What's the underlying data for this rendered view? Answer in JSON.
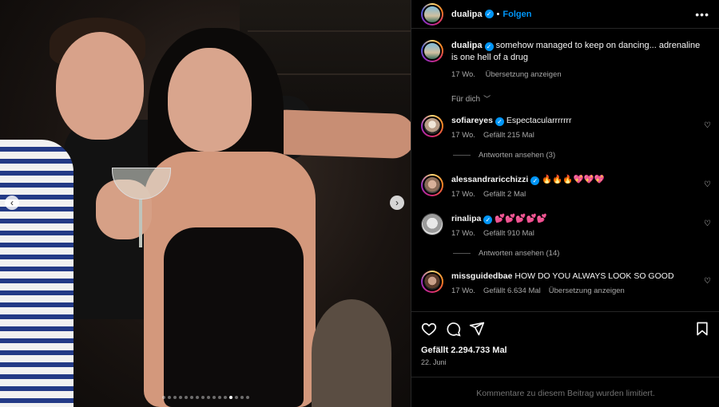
{
  "header": {
    "username": "dualipa",
    "separator": "•",
    "follow_label": "Folgen",
    "more_label": "•••"
  },
  "caption": {
    "username": "dualipa",
    "text": "somehow managed to keep on dancing... adrenaline is one hell of a drug",
    "age": "17 Wo.",
    "translate": "Übersetzung anzeigen"
  },
  "filter": {
    "label": "Für dich",
    "chevron": "﹀"
  },
  "comments": [
    {
      "username": "sofiareyes",
      "text": "Espectacularrrrrrr",
      "age": "17 Wo.",
      "likes": "Gefällt 215 Mal",
      "replies": "Antworten ansehen (3)"
    },
    {
      "username": "alessandraricchizzi",
      "text": "🔥🔥🔥💖💖💖",
      "age": "17 Wo.",
      "likes": "Gefällt 2 Mal"
    },
    {
      "username": "rinalipa",
      "text": "💕💕💕💕💕",
      "age": "17 Wo.",
      "likes": "Gefällt 910 Mal",
      "replies": "Antworten ansehen (14)"
    },
    {
      "username": "missguidedbae",
      "text": "HOW DO YOU ALWAYS LOOK SO GOOD",
      "age": "17 Wo.",
      "likes": "Gefällt 6.634 Mal",
      "translate": "Übersetzung anzeigen"
    }
  ],
  "post": {
    "likes": "Gefällt 2.294.733 Mal",
    "date": "22. Juni",
    "comments_limited": "Kommentare zu diesem Beitrag wurden limitiert."
  },
  "carousel": {
    "total": 16,
    "active_index": 12,
    "prev_glyph": "‹",
    "next_glyph": "›"
  },
  "colors": {
    "background": "#000000",
    "accent": "#0095f6",
    "secondary_text": "#a8a8a8"
  },
  "icons": [
    "verified-badge-icon",
    "heart-icon",
    "comment-icon",
    "share-icon",
    "bookmark-icon",
    "more-icon"
  ]
}
